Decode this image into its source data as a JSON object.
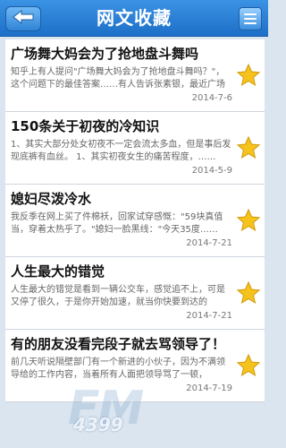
{
  "header": {
    "title": "网文收藏"
  },
  "articles": [
    {
      "title": "广场舞大妈会为了抢地盘斗舞吗",
      "summary": "知乎上有人提问\"广场舞大妈会为了抢地盘斗舞吗？\"，这个问题下的最佳答案……有人告诉张素银，最近广场不……",
      "date": "2014-7-6"
    },
    {
      "title": "150条关于初夜的冷知识",
      "summary": "1、其实大部分处女初夜不一定会流太多血，但是事后发现底裤有血丝。 1、其实初夜女生的痛苦程度，……",
      "date": "2014-5-9"
    },
    {
      "title": "媳妇尽泼冷水",
      "summary": "我反季在网上买了件棉袄，回家试穿感慨：\"59块真值当，穿着太热乎了。\"媳妇一脸黑线：\"今天35度……",
      "date": "2014-7-21"
    },
    {
      "title": "人生最大的错觉",
      "summary": "人生最大的错觉是看到一辆公交车，感觉追不上，可是又停了很久，于是你开始加速，就当你快要到达的时……",
      "date": "2014-7-21"
    },
    {
      "title": "有的朋友没看完段子就去骂领导了！",
      "summary": "前几天听说隔壁部门有一个新进的小伙子，因为不满领导给的工作内容，当着所有人面把领导骂了一顿，把……",
      "date": "2014-7-19"
    }
  ],
  "watermark": {
    "big": "FM",
    "small": "4399"
  },
  "colors": {
    "header": "#1d6fc7",
    "star": "#f5c31c"
  }
}
